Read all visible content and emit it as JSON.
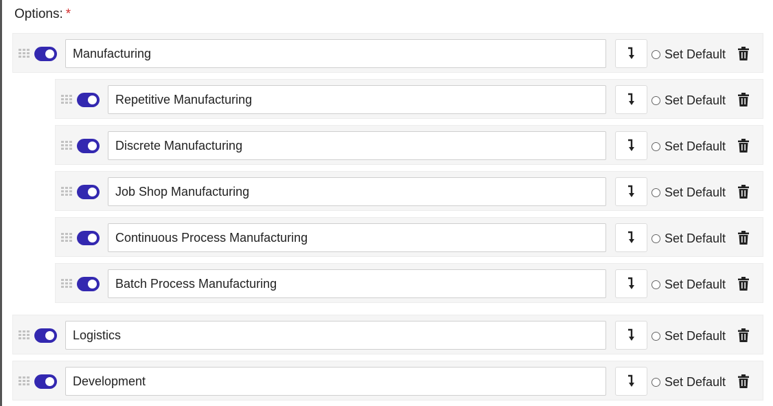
{
  "form": {
    "label": "Options:",
    "required_marker": "*"
  },
  "options": [
    {
      "label": "Manufacturing",
      "level": 0,
      "enabled": true
    },
    {
      "label": "Repetitive Manufacturing",
      "level": 1,
      "enabled": true
    },
    {
      "label": "Discrete Manufacturing",
      "level": 1,
      "enabled": true
    },
    {
      "label": "Job Shop Manufacturing",
      "level": 1,
      "enabled": true
    },
    {
      "label": "Continuous Process Manufacturing",
      "level": 1,
      "enabled": true
    },
    {
      "label": "Batch Process Manufacturing",
      "level": 1,
      "enabled": true
    },
    {
      "label": "Logistics",
      "level": 0,
      "enabled": true
    },
    {
      "label": "Development",
      "level": 0,
      "enabled": true
    }
  ],
  "row_actions": {
    "set_default_label": "Set Default",
    "subitem_icon": "arrow-turn-down-icon",
    "delete_icon": "trash-icon",
    "drag_icon": "drag-handle-icon",
    "toggle_icon": "toggle-switch"
  },
  "colors": {
    "toggle_on": "#3328b0",
    "required": "#d32f2f",
    "row_bg": "#f5f5f5"
  }
}
